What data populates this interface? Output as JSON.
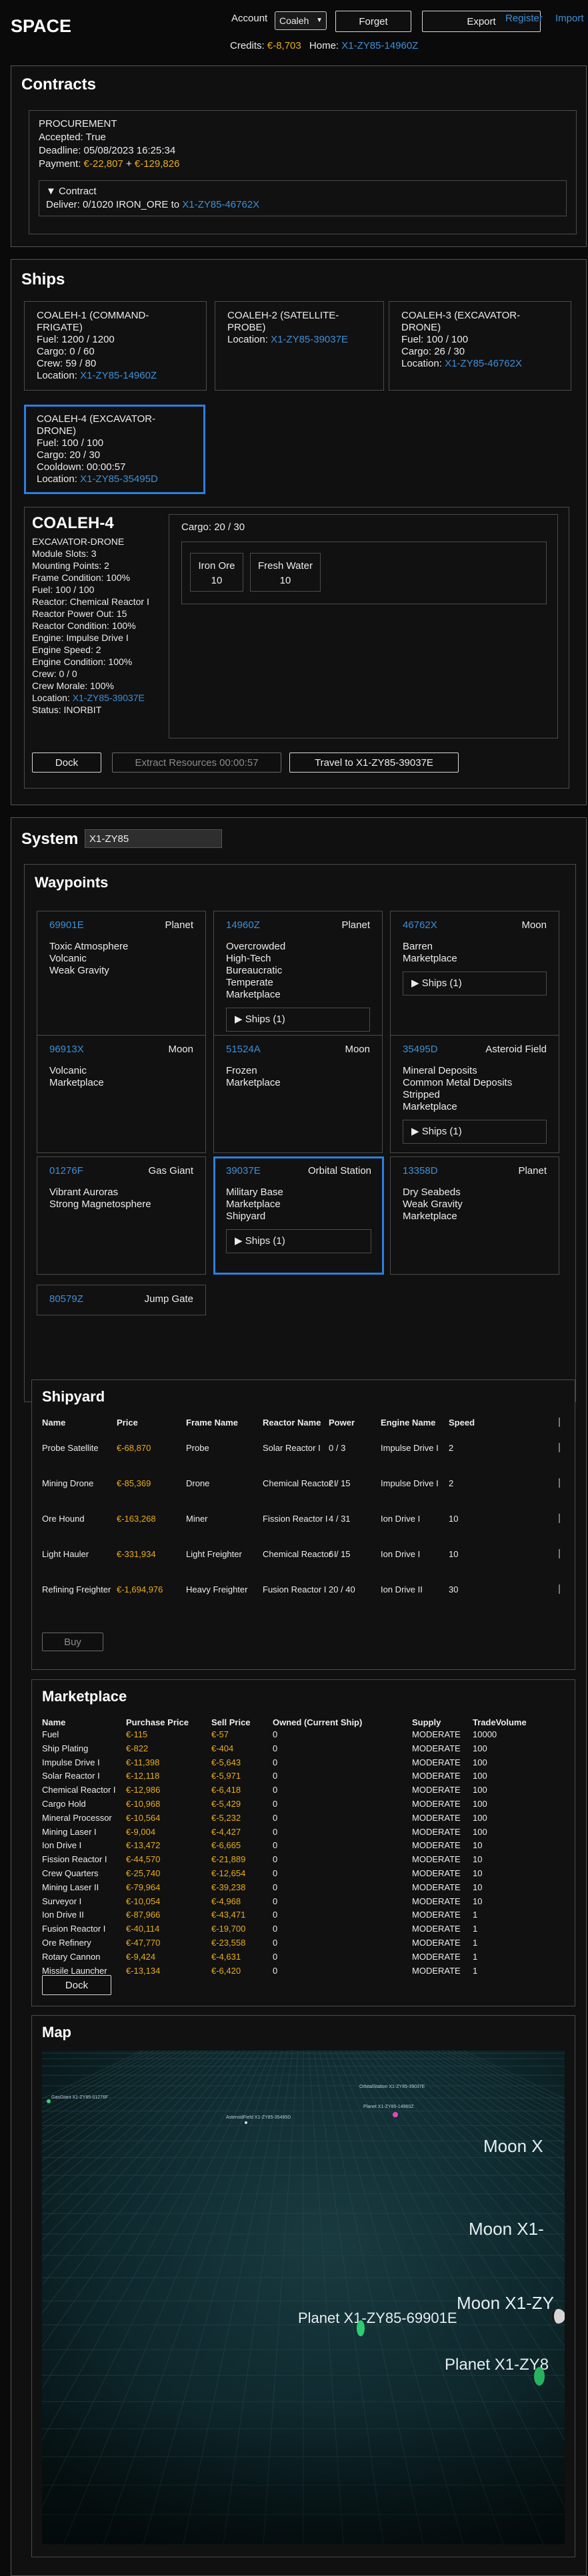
{
  "app": {
    "title": "SPACE"
  },
  "header": {
    "account_label": "Account",
    "account_value": "Coaleh",
    "forget_label": "Forget",
    "export_label": "Export",
    "register_label": "Register",
    "import_label": "Import",
    "credits_label": "Credits:",
    "credits_value": "€-8,703",
    "home_label": "Home:",
    "home_value": "X1-ZY85-14960Z"
  },
  "contracts": {
    "title": "Contracts",
    "type": "PROCUREMENT",
    "accepted": "Accepted: True",
    "deadline": "Deadline: 05/08/2023 16:25:34",
    "payment_label": "Payment:",
    "payment_a": "€-22,807",
    "payment_plus": "+",
    "payment_b": "€-129,826",
    "contract_toggle": "▼ Contract",
    "deliver_text": "Deliver: 0/1020 IRON_ORE to",
    "deliver_dest": "X1-ZY85-46762X"
  },
  "ships": {
    "title": "Ships",
    "cards": [
      {
        "name": "COALEH-1 (COMMAND-FRIGATE)",
        "lines": [
          "Fuel: 1200 / 1200",
          "Cargo: 0 / 60",
          "Crew: 59 / 80"
        ],
        "location_label": "Location:",
        "location": "X1-ZY85-14960Z"
      },
      {
        "name": "COALEH-2 (SATELLITE-PROBE)",
        "lines": [],
        "location_label": "Location:",
        "location": "X1-ZY85-39037E"
      },
      {
        "name": "COALEH-3 (EXCAVATOR-DRONE)",
        "lines": [
          "Fuel: 100 / 100",
          "Cargo: 26 / 30"
        ],
        "location_label": "Location:",
        "location": "X1-ZY85-46762X"
      },
      {
        "name": "COALEH-4 (EXCAVATOR-DRONE)",
        "lines": [
          "Fuel: 100 / 100",
          "Cargo: 20 / 30",
          "Cooldown: 00:00:57"
        ],
        "location_label": "Location:",
        "location": "X1-ZY85-35495D"
      }
    ]
  },
  "ship_detail": {
    "name": "COALEH-4",
    "lines": [
      "EXCAVATOR-DRONE",
      "Module Slots: 3",
      "Mounting Points: 2",
      "Frame Condition: 100%",
      "Fuel: 100 / 100",
      "Reactor: Chemical Reactor I",
      "Reactor Power Out: 15",
      "Reactor Condition: 100%",
      "Engine: Impulse Drive I",
      "Engine Speed: 2",
      "Engine Condition: 100%",
      "Crew: 0 / 0",
      "Crew Morale: 100%"
    ],
    "location_label": "Location:",
    "location": "X1-ZY85-39037E",
    "status": "Status: INORBIT",
    "cargo_label": "Cargo: 20 / 30",
    "cargo_items": [
      {
        "name": "Iron Ore",
        "qty": "10"
      },
      {
        "name": "Fresh Water",
        "qty": "10"
      }
    ],
    "dock_label": "Dock",
    "extract_label": "Extract Resources 00:00:57",
    "travel_label": "Travel to X1-ZY85-39037E"
  },
  "system": {
    "title": "System",
    "input_value": "X1-ZY85",
    "waypoints_title": "Waypoints",
    "waypoints": [
      {
        "id": "69901E",
        "type": "Planet",
        "traits": [
          "Toxic Atmosphere",
          "Volcanic",
          "Weak Gravity"
        ],
        "ships": ""
      },
      {
        "id": "14960Z",
        "type": "Planet",
        "traits": [
          "Overcrowded",
          "High-Tech",
          "Bureaucratic",
          "Temperate",
          "Marketplace"
        ],
        "ships": "▶ Ships (1)"
      },
      {
        "id": "46762X",
        "type": "Moon",
        "traits": [
          "Barren",
          "Marketplace"
        ],
        "ships": "▶ Ships (1)"
      },
      {
        "id": "96913X",
        "type": "Moon",
        "traits": [
          "Volcanic",
          "Marketplace"
        ],
        "ships": ""
      },
      {
        "id": "51524A",
        "type": "Moon",
        "traits": [
          "Frozen",
          "Marketplace"
        ],
        "ships": ""
      },
      {
        "id": "35495D",
        "type": "Asteroid Field",
        "traits": [
          "Mineral Deposits",
          "Common Metal Deposits",
          "Stripped",
          "Marketplace"
        ],
        "ships": "▶ Ships (1)"
      },
      {
        "id": "01276F",
        "type": "Gas Giant",
        "traits": [
          "Vibrant Auroras",
          "Strong Magnetosphere"
        ],
        "ships": ""
      },
      {
        "id": "39037E",
        "type": "Orbital Station",
        "traits": [
          "Military Base",
          "Marketplace",
          "Shipyard"
        ],
        "ships": "▶ Ships (1)"
      },
      {
        "id": "13358D",
        "type": "Planet",
        "traits": [
          "Dry Seabeds",
          "Weak Gravity",
          "Marketplace"
        ],
        "ships": ""
      },
      {
        "id": "80579Z",
        "type": "Jump Gate",
        "traits": [],
        "ships": ""
      }
    ]
  },
  "shipyard": {
    "title": "Shipyard",
    "headers": [
      "Name",
      "Price",
      "Frame Name",
      "Reactor Name",
      "Power",
      "Engine Name",
      "Speed"
    ],
    "rows": [
      [
        "Probe Satellite",
        "€-68,870",
        "Probe",
        "Solar Reactor I",
        "0 / 3",
        "Impulse Drive I",
        "2"
      ],
      [
        "Mining Drone",
        "€-85,369",
        "Drone",
        "Chemical Reactor I",
        "2 / 15",
        "Impulse Drive I",
        "2"
      ],
      [
        "Ore Hound",
        "€-163,268",
        "Miner",
        "Fission Reactor I",
        "4 / 31",
        "Ion Drive I",
        "10"
      ],
      [
        "Light Hauler",
        "€-331,934",
        "Light Freighter",
        "Chemical Reactor I",
        "6 / 15",
        "Ion Drive I",
        "10"
      ],
      [
        "Refining Freighter",
        "€-1,694,976",
        "Heavy Freighter",
        "Fusion Reactor I",
        "20 / 40",
        "Ion Drive II",
        "30"
      ]
    ],
    "buy_label": "Buy"
  },
  "marketplace": {
    "title": "Marketplace",
    "headers": [
      "Name",
      "Purchase Price",
      "Sell Price",
      "Owned (Current Ship)",
      "Supply",
      "TradeVolume"
    ],
    "rows": [
      [
        "Fuel",
        "€-115",
        "€-57",
        "0",
        "MODERATE",
        "10000"
      ],
      [
        "Ship Plating",
        "€-822",
        "€-404",
        "0",
        "MODERATE",
        "100"
      ],
      [
        "Impulse Drive I",
        "€-11,398",
        "€-5,643",
        "0",
        "MODERATE",
        "100"
      ],
      [
        "Solar Reactor I",
        "€-12,118",
        "€-5,971",
        "0",
        "MODERATE",
        "100"
      ],
      [
        "Chemical Reactor I",
        "€-12,986",
        "€-6,418",
        "0",
        "MODERATE",
        "100"
      ],
      [
        "Cargo Hold",
        "€-10,968",
        "€-5,429",
        "0",
        "MODERATE",
        "100"
      ],
      [
        "Mineral Processor",
        "€-10,564",
        "€-5,232",
        "0",
        "MODERATE",
        "100"
      ],
      [
        "Mining Laser I",
        "€-9,004",
        "€-4,427",
        "0",
        "MODERATE",
        "100"
      ],
      [
        "Ion Drive I",
        "€-13,472",
        "€-6,665",
        "0",
        "MODERATE",
        "10"
      ],
      [
        "Fission Reactor I",
        "€-44,570",
        "€-21,889",
        "0",
        "MODERATE",
        "10"
      ],
      [
        "Crew Quarters",
        "€-25,740",
        "€-12,654",
        "0",
        "MODERATE",
        "10"
      ],
      [
        "Mining Laser II",
        "€-79,964",
        "€-39,238",
        "0",
        "MODERATE",
        "10"
      ],
      [
        "Surveyor I",
        "€-10,054",
        "€-4,968",
        "0",
        "MODERATE",
        "10"
      ],
      [
        "Ion Drive II",
        "€-87,966",
        "€-43,471",
        "0",
        "MODERATE",
        "1"
      ],
      [
        "Fusion Reactor I",
        "€-40,114",
        "€-19,700",
        "0",
        "MODERATE",
        "1"
      ],
      [
        "Ore Refinery",
        "€-47,770",
        "€-23,558",
        "0",
        "MODERATE",
        "1"
      ],
      [
        "Rotary Cannon",
        "€-9,424",
        "€-4,631",
        "0",
        "MODERATE",
        "1"
      ],
      [
        "Missile Launcher",
        "€-13,134",
        "€-6,420",
        "0",
        "MODERATE",
        "1"
      ]
    ],
    "dock_label": "Dock"
  },
  "map": {
    "title": "Map",
    "labels": [
      "Moon X",
      "Moon X1-",
      "Moon X1-ZY",
      "Planet X1-ZY85-69901E",
      "Planet X1-ZY8"
    ],
    "small_labels": [
      "OrbitalStation X1-ZY85-39037E",
      "AsteroidField X1-ZY85-35495D",
      "Planet X1-ZY85-14960Z",
      "GasGiant X1-ZY85-01276F"
    ],
    "colors": {
      "bg": "#0e2a2e",
      "grid": "#2c4e52",
      "planet_green": "#3ad17a"
    }
  }
}
